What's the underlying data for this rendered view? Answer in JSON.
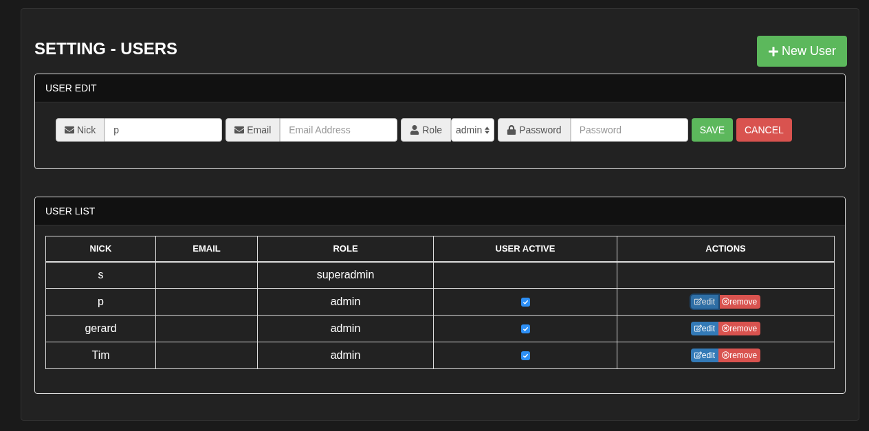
{
  "title": "SETTING - USERS",
  "new_user_button": "New User",
  "user_edit": {
    "heading": "USER EDIT",
    "fields": [
      {
        "kind": "text",
        "label": "Nick",
        "value": "p"
      },
      {
        "kind": "text",
        "label": "Email",
        "placeholder": "Email Address"
      },
      {
        "kind": "select",
        "label": "Role",
        "value": "admin"
      },
      {
        "kind": "text",
        "label": "Password",
        "placeholder": "Password"
      }
    ],
    "buttons": [
      {
        "kind": "save",
        "label": "SAVE"
      },
      {
        "kind": "cancel",
        "label": "CANCEL"
      }
    ]
  },
  "user_list": {
    "heading": "USER LIST",
    "columns": [
      "NICK",
      "EMAIL",
      "ROLE",
      "USER ACTIVE",
      "ACTIONS"
    ],
    "rows": [
      {
        "nick": "s",
        "role": "superadmin"
      },
      {
        "nick": "p",
        "role": "admin",
        "active": true,
        "actions": [
          {
            "kind": "edit",
            "label": "edit",
            "focused": true
          },
          {
            "kind": "remove",
            "label": "remove",
            "focused": false
          }
        ]
      },
      {
        "nick": "gerard",
        "role": "admin",
        "active": true,
        "actions": [
          {
            "kind": "edit",
            "label": "edit",
            "focused": false
          },
          {
            "kind": "remove",
            "label": "remove",
            "focused": false
          }
        ]
      },
      {
        "nick": "Tim",
        "role": "admin",
        "active": true,
        "actions": [
          {
            "kind": "edit",
            "label": "edit",
            "focused": false
          },
          {
            "kind": "remove",
            "label": "remove",
            "focused": false
          }
        ]
      }
    ]
  }
}
